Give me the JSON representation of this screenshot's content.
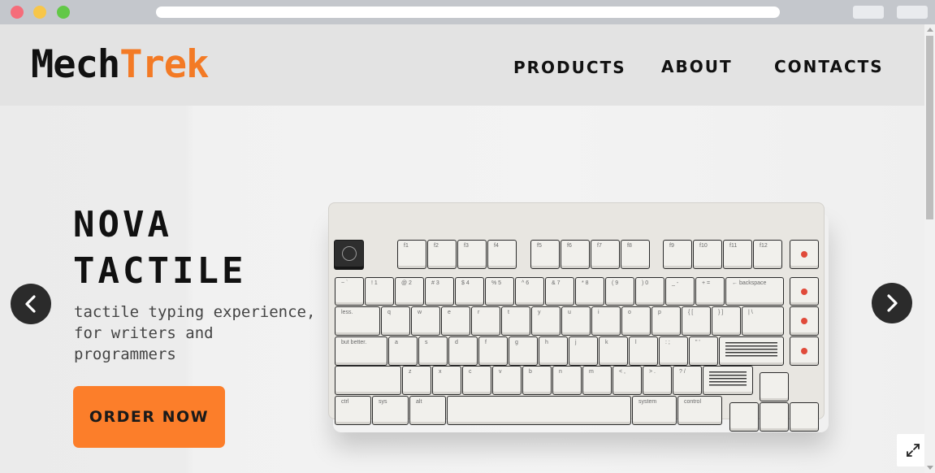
{
  "brand": {
    "part1": "Mech",
    "part2": "Trek",
    "accent_color": "#f37a25"
  },
  "nav": {
    "products": "PRODUCTS",
    "about": "ABOUT",
    "contacts": "CONTACTS"
  },
  "hero": {
    "title_line1": "NOVA",
    "title_line2": "TACTILE",
    "subtitle_line1": "tactile typing experience,",
    "subtitle_line2": "for writers and",
    "subtitle_line3": "programmers",
    "cta_label": "ORDER NOW",
    "cta_color": "#fc7e2a"
  },
  "carousel": {
    "prev_icon": "chevron-left-icon",
    "next_icon": "chevron-right-icon"
  },
  "fullscreen_icon": "expand-icon",
  "keyboard": {
    "function_row": [
      "f1",
      "f2",
      "f3",
      "f4",
      "f5",
      "f6",
      "f7",
      "f8",
      "f9",
      "f10",
      "f11",
      "f12"
    ],
    "number_row": [
      "~ `",
      "! 1",
      "@ 2",
      "# 3",
      "$ 4",
      "% 5",
      "^ 6",
      "& 7",
      "* 8",
      "( 9",
      ") 0",
      "_ -",
      "+ =",
      "← backspace"
    ],
    "top_row": [
      "less.",
      "q",
      "w",
      "e",
      "r",
      "t",
      "y",
      "u",
      "i",
      "o",
      "p",
      "{ [",
      "} ]",
      "| \\"
    ],
    "home_row": [
      "but better.",
      "a",
      "s",
      "d",
      "f",
      "g",
      "h",
      "j",
      "k",
      "l",
      ": ;",
      "\" '"
    ],
    "bottom_row": [
      "z",
      "x",
      "c",
      "v",
      "b",
      "n",
      "m",
      "< ,",
      "> .",
      "? /"
    ],
    "space_row": [
      "ctrl",
      "sys",
      "alt",
      "system",
      "control"
    ]
  }
}
